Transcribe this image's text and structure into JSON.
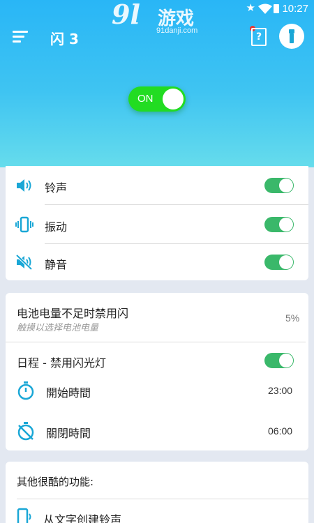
{
  "status_bar": {
    "time": "10:27"
  },
  "watermark": {
    "logo": "9l",
    "site_name": "游戏",
    "url": "91danji.com"
  },
  "header": {
    "title": "闪 3",
    "main_toggle_label": "ON"
  },
  "sound_modes": {
    "items": [
      {
        "label": "铃声",
        "icon": "volume-icon",
        "enabled": true
      },
      {
        "label": "振动",
        "icon": "vibrate-icon",
        "enabled": true
      },
      {
        "label": "静音",
        "icon": "mute-icon",
        "enabled": true
      }
    ]
  },
  "battery": {
    "title": "电池电量不足时禁用闪",
    "subtitle": "触摸以选择电池电量",
    "value": "5%"
  },
  "schedule": {
    "title": "日程 - 禁用闪光灯",
    "enabled": true,
    "start_label": "開始時間",
    "start_value": "23:00",
    "end_label": "關閉時間",
    "end_value": "06:00"
  },
  "features": {
    "title": "其他很酷的功能:",
    "items": [
      {
        "label": "从文字创建铃声",
        "icon": "phone-icon"
      }
    ]
  },
  "colors": {
    "header_top": "#29b6f6",
    "header_bottom": "#66dcec",
    "toggle_on": "#3ab86a",
    "main_toggle": "#22dc22",
    "icon_accent": "#1aa7d6"
  }
}
